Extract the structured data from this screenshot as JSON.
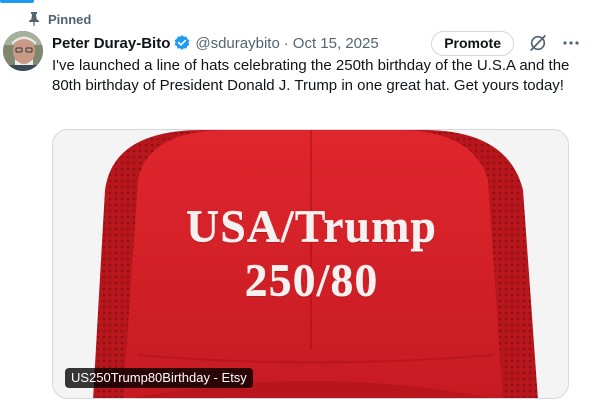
{
  "pinned_label": "Pinned",
  "author": {
    "name": "Peter Duray-Bito",
    "handle": "@sduraybito",
    "date": "Oct 15, 2025"
  },
  "actions": {
    "promote_label": "Promote"
  },
  "tweet": {
    "text": "I've launched a line of hats celebrating the 250th birthday of the U.S.A and the 80th birthday of President Donald J. Trump in one great hat. Get yours today!"
  },
  "media": {
    "hat_line1": "USA/Trump",
    "hat_line2": "250/80",
    "link_label": "US250Trump80Birthday - Etsy"
  },
  "icons": {
    "pin": "pin-icon",
    "verified": "verified-badge-icon",
    "grok": "grok-icon",
    "more": "more-options-icon"
  },
  "colors": {
    "accent": "#1d9bf0",
    "secondary_text": "#536471",
    "hat_red": "#d81f26"
  }
}
